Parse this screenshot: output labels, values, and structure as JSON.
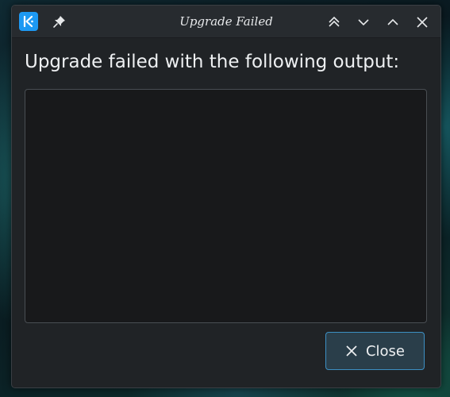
{
  "window": {
    "title": "Upgrade Failed"
  },
  "titlebar": {
    "app_icon": "kde-logo-icon",
    "pin_icon": "pin-icon",
    "buttons": [
      "keep-above-icon",
      "minimize-icon",
      "maximize-icon",
      "close-icon"
    ]
  },
  "main": {
    "heading": "Upgrade failed with the following output:",
    "output_text": ""
  },
  "footer": {
    "close_label": "Close",
    "close_icon": "close-icon"
  },
  "colors": {
    "window_bg": "#202326",
    "titlebar_bg": "#272b2f",
    "output_bg": "#18191b",
    "accent": "#3c8fc3",
    "kde_blue": "#1d99f3"
  }
}
